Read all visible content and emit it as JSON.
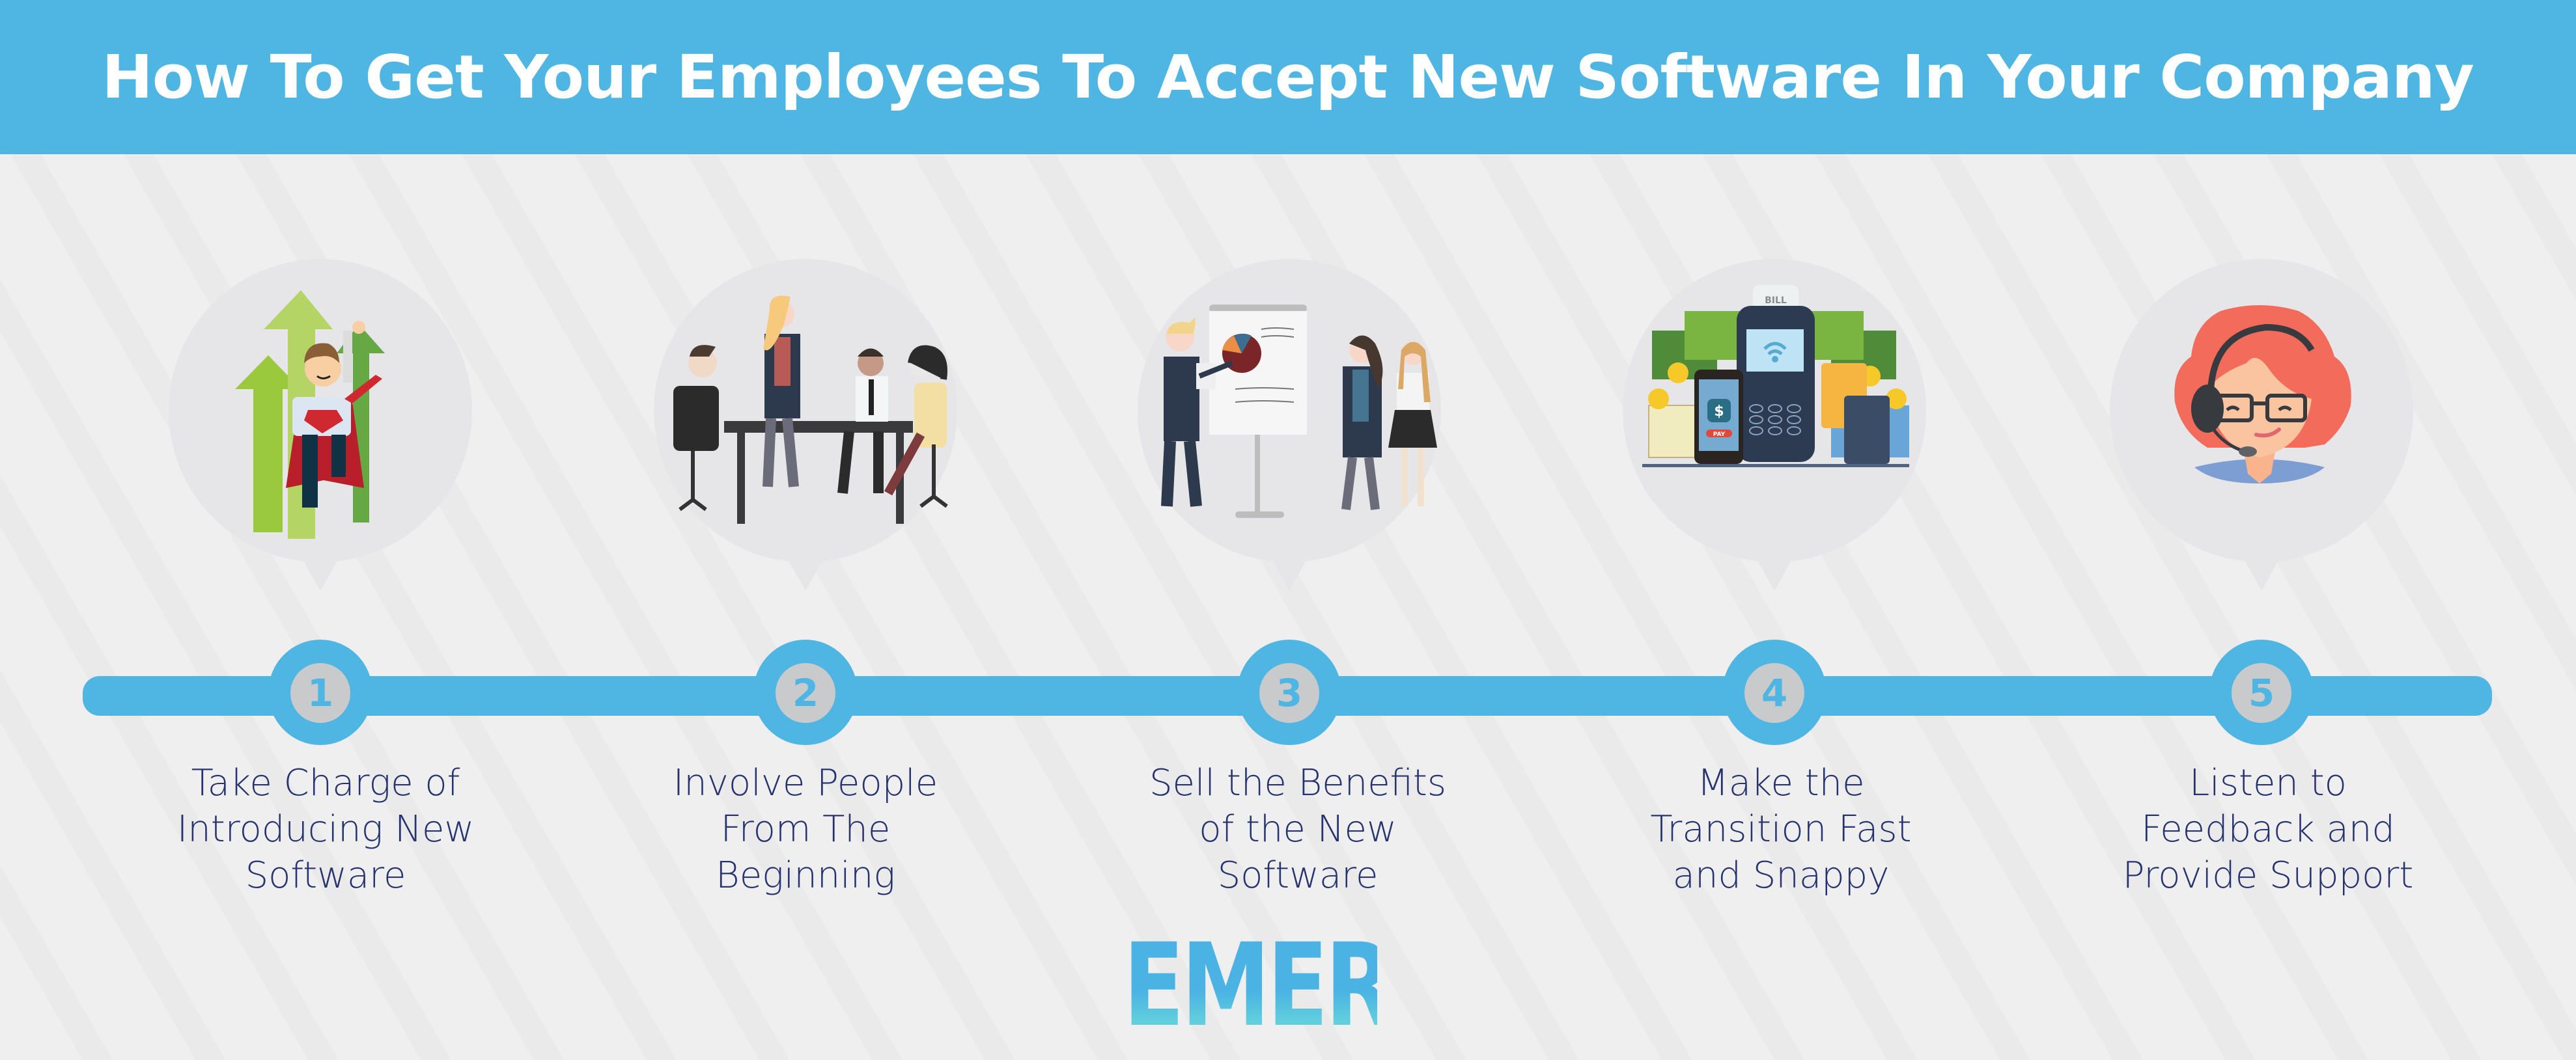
{
  "header": {
    "title": "How To Get Your Employees To Accept New Software In Your Company"
  },
  "colors": {
    "brand_blue": "#4fb5e3",
    "text_navy": "#27336f",
    "node_gray": "#c9cacb",
    "bubble_gray": "#e6e6e8"
  },
  "steps": [
    {
      "number": "1",
      "lines": [
        "Take Charge of",
        "Introducing New",
        "Software"
      ],
      "illustration": "superhero-businessman-icon"
    },
    {
      "number": "2",
      "lines": [
        "Involve People",
        "From The",
        "Beginning"
      ],
      "illustration": "team-meeting-icon"
    },
    {
      "number": "3",
      "lines": [
        "Sell the Benefits",
        "of the New",
        "Software"
      ],
      "illustration": "presentation-flipchart-icon"
    },
    {
      "number": "4",
      "lines": [
        "Make the",
        "Transition Fast",
        "and Snappy"
      ],
      "illustration": "payment-terminal-icon",
      "bill_label": "BILL",
      "pay_label": "PAY"
    },
    {
      "number": "5",
      "lines": [
        "Listen to",
        "Feedback and",
        "Provide Support"
      ],
      "illustration": "support-agent-headset-icon"
    }
  ],
  "footer": {
    "logo": "EMERGE"
  }
}
